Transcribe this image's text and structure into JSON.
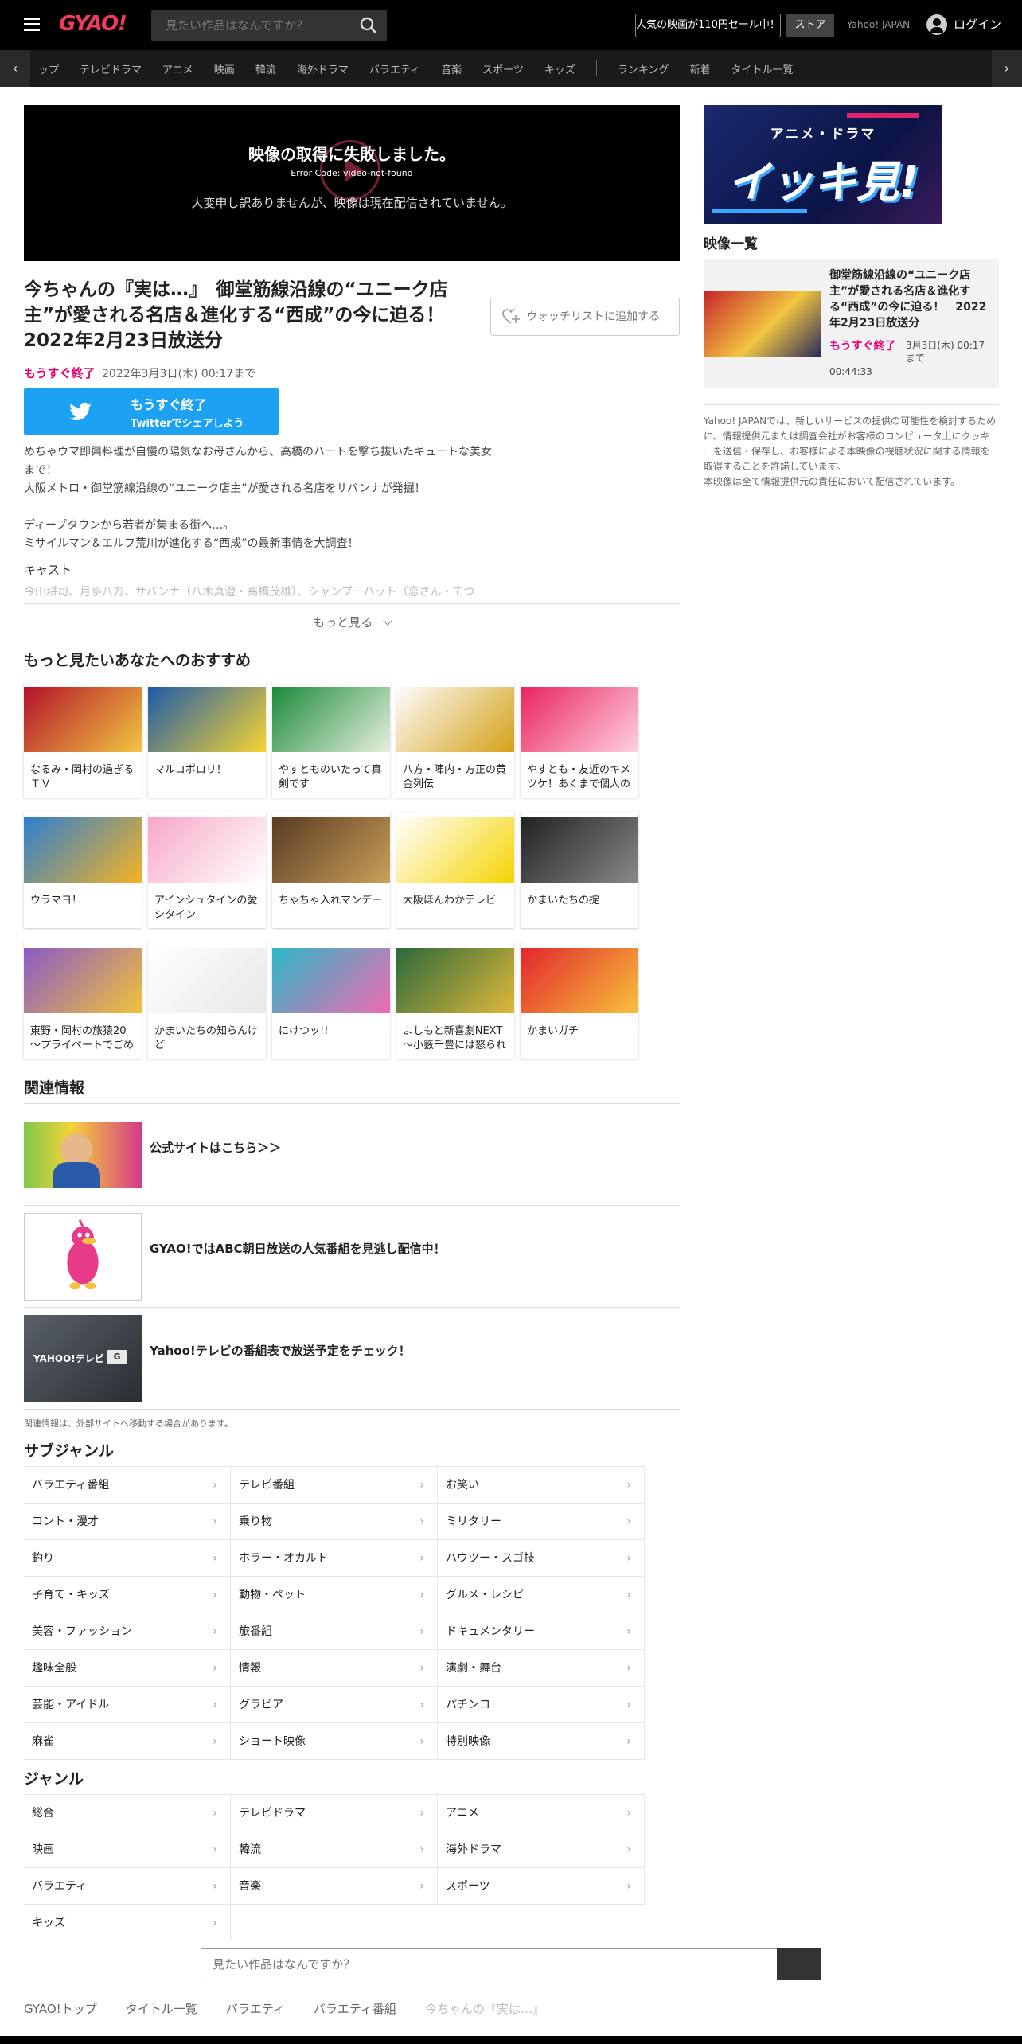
{
  "header": {
    "logo": "GYAO!",
    "search_placeholder": "見たい作品はなんですか？",
    "sale": "人気の映画が110円セール中！",
    "store": "ストア",
    "yahoo_japan": "Yahoo! JAPAN",
    "login": "ログイン"
  },
  "nav": {
    "prev": "‹",
    "next": "›",
    "items": [
      "ップ",
      "テレビドラマ",
      "アニメ",
      "映画",
      "韓流",
      "海外ドラマ",
      "バラエティ",
      "音楽",
      "スポーツ",
      "キッズ"
    ],
    "items2": [
      "ランキング",
      "新着",
      "タイトル一覧"
    ]
  },
  "video": {
    "error_title": "映像の取得に失敗しました。",
    "error_code": "Error Code: video-not-found",
    "error_message": "大変申し訳ありませんが、映像は現在配信されていません。"
  },
  "program": {
    "title": "今ちゃんの『実は…』　御堂筋線沿線の“ユニーク店主”が愛される名店＆進化する“西成”の今に迫る！　2022年2月23日放送分",
    "watchlist": "ウォッチリストに追加する",
    "end_soon": "もうすぐ終了",
    "air_date": "2022年3月3日(木) 00:17まで",
    "twitter_l1": "もうすぐ終了",
    "twitter_l2": "Twitterでシェアしよう",
    "desc": [
      "めちゃウマ即興料理が自慢の陽気なお母さんから、高橋のハートを撃ち抜いたキュートな美女",
      "まで！",
      "大阪メトロ・御堂筋線沿線の“ユニーク店主”が愛される名店をサバンナが発掘！",
      "",
      "ディープタウンから若者が集まる街へ…。",
      "ミサイルマン＆エルフ荒川が進化する“西成”の最新事情を大調査！"
    ],
    "cast_label": "キャスト",
    "cast": "今田耕司、月亭八方、サバンナ（八木真澄・高橋茂雄）、シャンプーハット（恋さん・てつ",
    "more": "もっと見る"
  },
  "recommend": {
    "heading": "もっと見たいあなたへのおすすめ",
    "items": [
      {
        "title": "なるみ・岡村の過ぎるＴＶ",
        "c1": "#b3122a",
        "c2": "#f2c641"
      },
      {
        "title": "マルコポロリ！",
        "c1": "#1d5aa8",
        "c2": "#f7d432"
      },
      {
        "title": "やすとものいたって真剣です",
        "c1": "#1b8a3a",
        "c2": "#e7f0e0"
      },
      {
        "title": "八方・陣内・方正の黄金列伝",
        "c1": "#fdfdfd",
        "c2": "#d4a017"
      },
      {
        "title": "やすとも・友近のキメツケ！あくまで個人の",
        "c1": "#e8245f",
        "c2": "#ffd1e0"
      },
      {
        "title": "ウラマヨ！",
        "c1": "#2d7fd0",
        "c2": "#f5b324"
      },
      {
        "title": "アインシュタインの愛シタイン",
        "c1": "#f7a8c8",
        "c2": "#ffffff"
      },
      {
        "title": "ちゃちゃ入れマンデー",
        "c1": "#5a3a22",
        "c2": "#c9a15a"
      },
      {
        "title": "大阪ほんわかテレビ",
        "c1": "#ffffff",
        "c2": "#f5d400"
      },
      {
        "title": "かまいたちの掟",
        "c1": "#222222",
        "c2": "#888888"
      },
      {
        "title": "東野・岡村の旅猿20～プライベートでごめ",
        "c1": "#8a5ac8",
        "c2": "#f2c23a"
      },
      {
        "title": "かまいたちの知らんけど",
        "c1": "#ffffff",
        "c2": "#e8e8e8"
      },
      {
        "title": "にけつッ!!",
        "c1": "#2bb8c8",
        "c2": "#f06ab0"
      },
      {
        "title": "よしもと新喜劇NEXT～小籔千豊には怒られ",
        "c1": "#2a6a3a",
        "c2": "#e0b83a"
      },
      {
        "title": "かまいガチ",
        "c1": "#e2262e",
        "c2": "#f7c23a"
      }
    ]
  },
  "related": {
    "heading": "関連情報",
    "items": [
      {
        "text": "公式サイトはこちら＞＞"
      },
      {
        "text": "GYAO!ではABC朝日放送の人気番組を見逃し配信中！"
      },
      {
        "text": "Yahoo!テレビの番組表で放送予定をチェック！"
      }
    ],
    "note": "関連情報は、外部サイトへ移動する場合があります。",
    "tv_logo": "YAHOO!テレビ",
    "g_logo": "G"
  },
  "subgenre": {
    "heading": "サブジャンル",
    "items": [
      "バラエティ番組",
      "テレビ番組",
      "お笑い",
      "コント・漫才",
      "乗り物",
      "ミリタリー",
      "釣り",
      "ホラー・オカルト",
      "ハウツー・スゴ技",
      "子育て・キッズ",
      "動物・ペット",
      "グルメ・レシピ",
      "美容・ファッション",
      "旅番組",
      "ドキュメンタリー",
      "趣味全般",
      "情報",
      "演劇・舞台",
      "芸能・アイドル",
      "グラビア",
      "パチンコ",
      "麻雀",
      "ショート映像",
      "特別映像"
    ]
  },
  "genre": {
    "heading": "ジャンル",
    "items": [
      "総合",
      "テレビドラマ",
      "アニメ",
      "映画",
      "韓流",
      "海外ドラマ",
      "バラエティ",
      "音楽",
      "スポーツ",
      "キッズ"
    ]
  },
  "chevron": "›",
  "footer": {
    "search_placeholder": "見たい作品はなんですか？",
    "breadcrumb": [
      "GYAO!トップ",
      "タイトル一覧",
      "バラエティ",
      "バラエティ番組",
      "今ちゃんの『実は…』"
    ]
  },
  "sidebar": {
    "banner_l1": "アニメ・ドラマ",
    "banner_l2": "イッキ見!",
    "list_label": "映像一覧",
    "video_title": "御堂筋線沿線の“ユニーク店主”が愛される名店＆進化する“西成”の今に迫る！　2022年2月23日放送分",
    "video_end": "もうすぐ終了",
    "video_date": "3月3日(木) 00:17まで",
    "video_duration": "00:44:33",
    "notes": [
      "Yahoo! JAPANでは、新しいサービスの提供の可能性を検討するために、情報提供元または調査会社がお客様のコンピュータ上にクッキーを送信・保存し、お客様による本映像の視聴状況に関する情報を取得することを許諾しています。",
      "本映像は全て情報提供元の責任において配信されています。"
    ]
  }
}
